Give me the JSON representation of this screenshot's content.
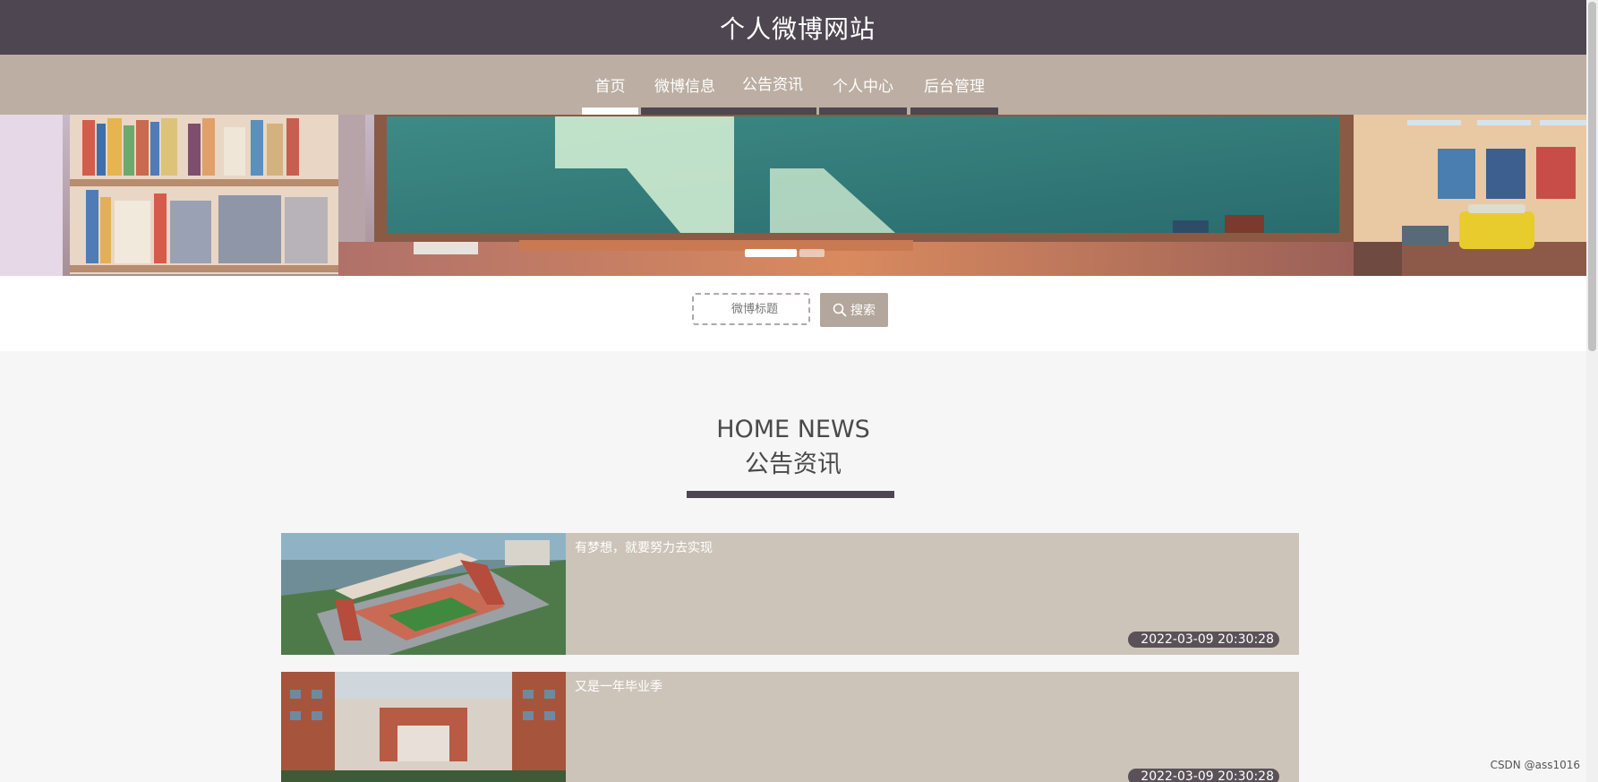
{
  "header": {
    "site_title": "个人微博网站"
  },
  "nav": {
    "items": [
      {
        "label": "首页",
        "active": true
      },
      {
        "label": "微博信息",
        "active": false
      },
      {
        "label": "公告资讯",
        "active": false
      },
      {
        "label": "个人中心",
        "active": false
      },
      {
        "label": "后台管理",
        "active": false
      }
    ]
  },
  "search": {
    "placeholder": "微博标题",
    "button_label": "搜索"
  },
  "news": {
    "heading_en": "HOME NEWS",
    "heading_cn": "公告资讯",
    "items": [
      {
        "title": "有梦想，就要努力去实现",
        "date": "2022-03-09 20:30:28"
      },
      {
        "title": "又是一年毕业季",
        "date": "2022-03-09 20:30:28"
      }
    ]
  },
  "watermark": "CSDN @ass1016",
  "colors": {
    "topbar": "#4e4650",
    "navbar": "#bcaea2",
    "card": "#cdc4b9",
    "search_button": "#b3a69c"
  }
}
